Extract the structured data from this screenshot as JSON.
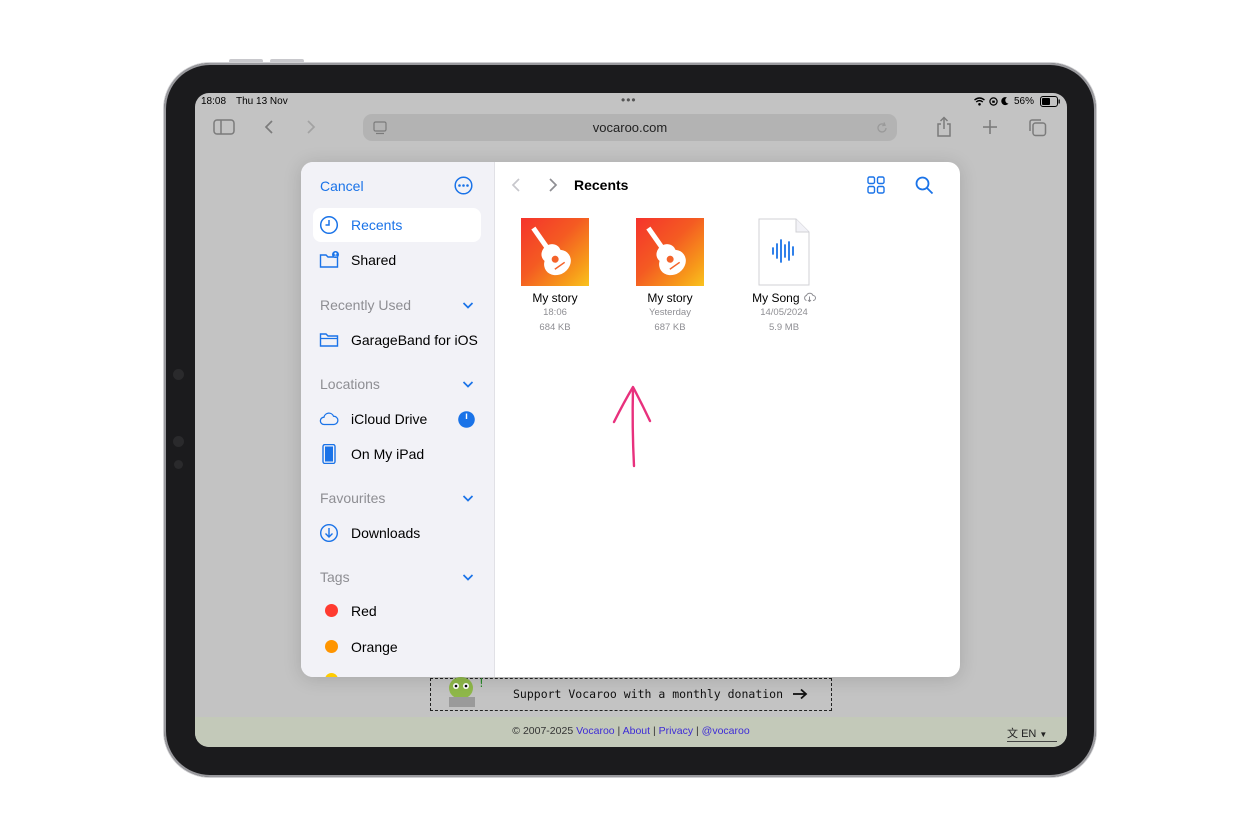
{
  "status_bar": {
    "time": "18:08",
    "date": "Thu 13 Nov",
    "battery": "56%"
  },
  "browser": {
    "url": "vocaroo.com"
  },
  "picker": {
    "cancel_label": "Cancel",
    "title": "Recents",
    "sidebar": {
      "top_items": [
        {
          "label": "Recents",
          "icon": "clock-icon",
          "selected": true
        },
        {
          "label": "Shared",
          "icon": "shared-folder-icon",
          "selected": false
        }
      ],
      "recently_used": {
        "heading": "Recently Used",
        "items": [
          {
            "label": "GarageBand for iOS",
            "icon": "folder-icon"
          }
        ]
      },
      "locations": {
        "heading": "Locations",
        "items": [
          {
            "label": "iCloud Drive",
            "icon": "cloud-icon"
          },
          {
            "label": "On My iPad",
            "icon": "ipad-icon"
          }
        ]
      },
      "favourites": {
        "heading": "Favourites",
        "items": [
          {
            "label": "Downloads",
            "icon": "download-icon"
          }
        ]
      },
      "tags": {
        "heading": "Tags",
        "items": [
          {
            "label": "Red",
            "color": "#ff3b30"
          },
          {
            "label": "Orange",
            "color": "#ff9500"
          }
        ],
        "partial_color": "#ffcc00"
      }
    },
    "files": [
      {
        "name": "My story",
        "date": "18:06",
        "size": "684 KB",
        "icon": "garageband-icon"
      },
      {
        "name": "My story",
        "date": "Yesterday",
        "size": "687 KB",
        "icon": "garageband-icon"
      },
      {
        "name": "My Song",
        "date": "14/05/2024",
        "size": "5.9 MB",
        "icon": "audio-file-icon",
        "cloud": true
      }
    ]
  },
  "page": {
    "donation_text": "Support Vocaroo with a monthly donation",
    "footer_copyright": "© 2007-2025",
    "footer_links": [
      "Vocaroo",
      "About",
      "Privacy",
      "@vocaroo"
    ],
    "footer_sep": "|",
    "language": "EN"
  },
  "colors": {
    "accent": "#1a73e8",
    "annotation_arrow": "#e8317d"
  }
}
